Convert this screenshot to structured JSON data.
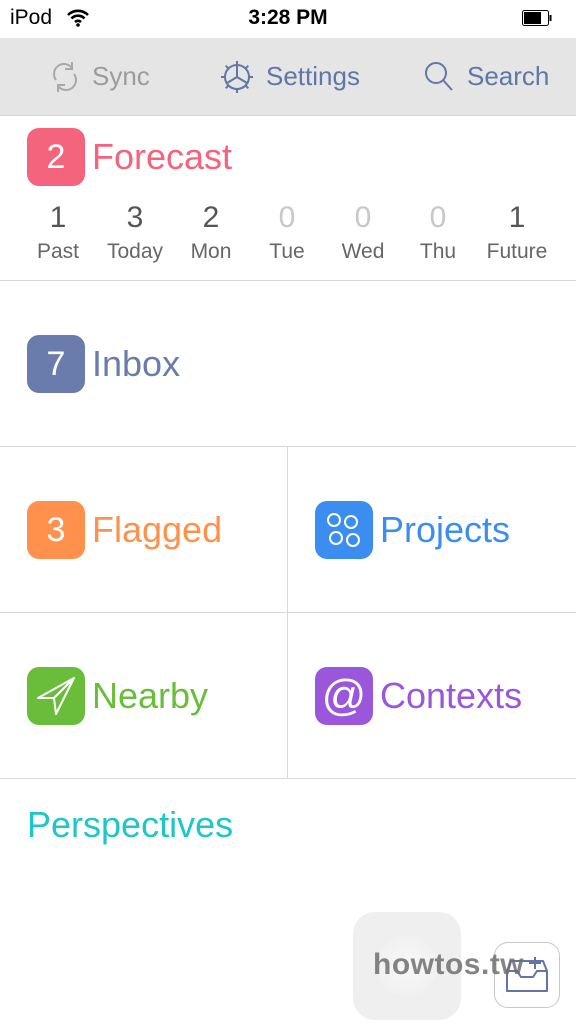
{
  "status_bar": {
    "device": "iPod",
    "time": "3:28 PM",
    "wifi_icon": "wifi-icon",
    "battery_icon": "battery-icon"
  },
  "toolbar": {
    "sync": {
      "label": "Sync",
      "icon": "sync-icon",
      "enabled": false
    },
    "settings": {
      "label": "Settings",
      "icon": "gear-icon"
    },
    "search": {
      "label": "Search",
      "icon": "search-icon"
    }
  },
  "forecast": {
    "badge": "2",
    "label": "Forecast",
    "color": "#f4647c",
    "days": [
      {
        "count": "1",
        "name": "Past"
      },
      {
        "count": "3",
        "name": "Today"
      },
      {
        "count": "2",
        "name": "Mon"
      },
      {
        "count": "0",
        "name": "Tue"
      },
      {
        "count": "0",
        "name": "Wed"
      },
      {
        "count": "0",
        "name": "Thu"
      },
      {
        "count": "1",
        "name": "Future"
      }
    ]
  },
  "inbox": {
    "badge": "7",
    "label": "Inbox",
    "color": "#6a7cab"
  },
  "flagged": {
    "badge": "3",
    "label": "Flagged",
    "color": "#ff914c"
  },
  "projects": {
    "label": "Projects",
    "icon": "projects-icon",
    "color": "#3b8eef"
  },
  "nearby": {
    "label": "Nearby",
    "icon": "location-arrow-icon",
    "color": "#6abd3b"
  },
  "contexts": {
    "label": "Contexts",
    "icon": "at-sign-icon",
    "color": "#9a57dc"
  },
  "perspectives": {
    "label": "Perspectives",
    "color": "#1ec6c8"
  },
  "bottom": {
    "quick_entry_icon": "inbox-add-icon",
    "assistive_touch_icon": "assistive-touch-icon"
  },
  "watermark": "howtos.tw"
}
